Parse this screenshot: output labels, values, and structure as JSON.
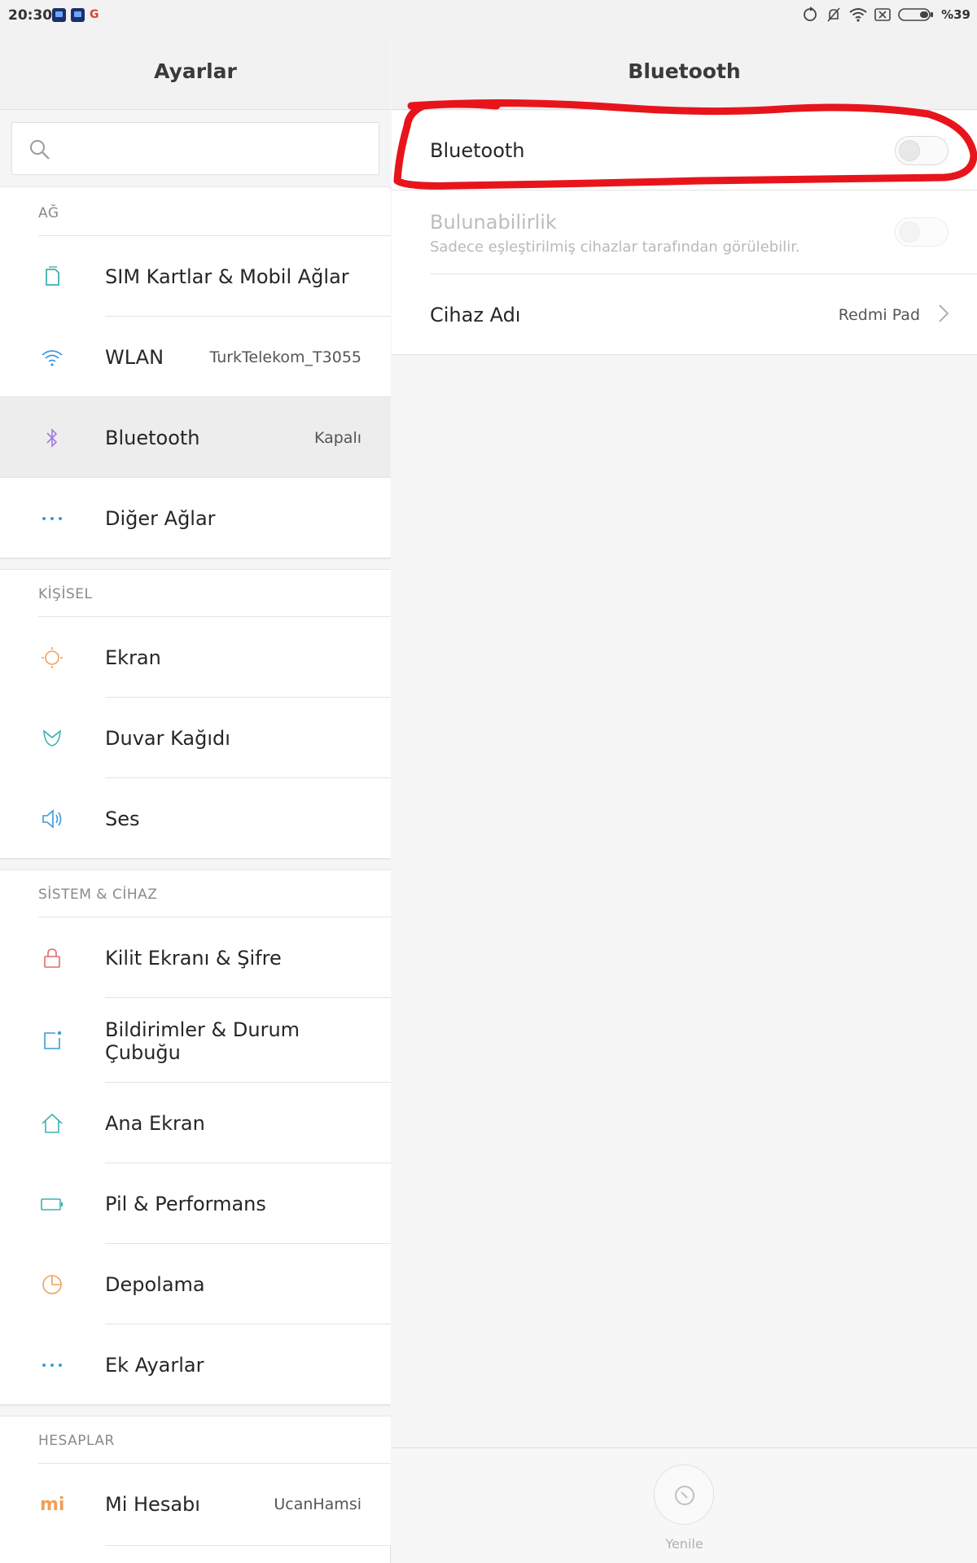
{
  "status_bar": {
    "time": "20:30",
    "google_letter": "G",
    "battery": "%39"
  },
  "left": {
    "title": "Ayarlar",
    "search_placeholder": "",
    "sections": {
      "network": "AĞ",
      "personal": "KİŞİSEL",
      "system": "SİSTEM & CİHAZ",
      "accounts": "HESAPLAR"
    },
    "items": {
      "sim": {
        "label": "SIM Kartlar & Mobil Ağlar",
        "icon": "sim-card-icon"
      },
      "wlan": {
        "label": "WLAN",
        "value": "TurkTelekom_T3055",
        "icon": "wifi-icon"
      },
      "bluetooth": {
        "label": "Bluetooth",
        "value": "Kapalı",
        "icon": "bluetooth-icon"
      },
      "other_networks": {
        "label": "Diğer Ağlar",
        "icon": "more-dots-icon"
      },
      "display": {
        "label": "Ekran",
        "icon": "brightness-icon"
      },
      "wallpaper": {
        "label": "Duvar Kağıdı",
        "icon": "wallpaper-icon"
      },
      "sound": {
        "label": "Ses",
        "icon": "speaker-icon"
      },
      "lock": {
        "label": "Kilit Ekranı & Şifre",
        "icon": "lock-icon"
      },
      "notifications": {
        "label_line1": "Bildirimler & Durum",
        "label_line2": "Çubuğu",
        "icon": "notification-icon"
      },
      "home": {
        "label": "Ana Ekran",
        "icon": "home-icon"
      },
      "battery": {
        "label": "Pil & Performans",
        "icon": "battery-icon"
      },
      "storage": {
        "label": "Depolama",
        "icon": "storage-icon"
      },
      "additional": {
        "label": "Ek Ayarlar",
        "icon": "more-dots-icon"
      },
      "mi_account": {
        "label": "Mi Hesabı",
        "value": "UcanHamsi",
        "icon": "mi-logo-icon",
        "logo_text": "mi"
      }
    }
  },
  "right": {
    "title": "Bluetooth",
    "bluetooth_toggle": {
      "label": "Bluetooth",
      "on": false
    },
    "visibility": {
      "label": "Bulunabilirlik",
      "subtitle": "Sadece eşleştirilmiş cihazlar tarafından görülebilir.",
      "on": false,
      "enabled": false
    },
    "device_name": {
      "label": "Cihaz Adı",
      "value": "Redmi Pad"
    },
    "refresh": {
      "label": "Yenile"
    }
  },
  "colors": {
    "annotation": "#e8141c",
    "icon_teal": "#3fb3ae",
    "icon_orange": "#f0a05a",
    "icon_purple": "#a07be0",
    "icon_red": "#e46a6a",
    "icon_blue": "#3a9ad9"
  }
}
